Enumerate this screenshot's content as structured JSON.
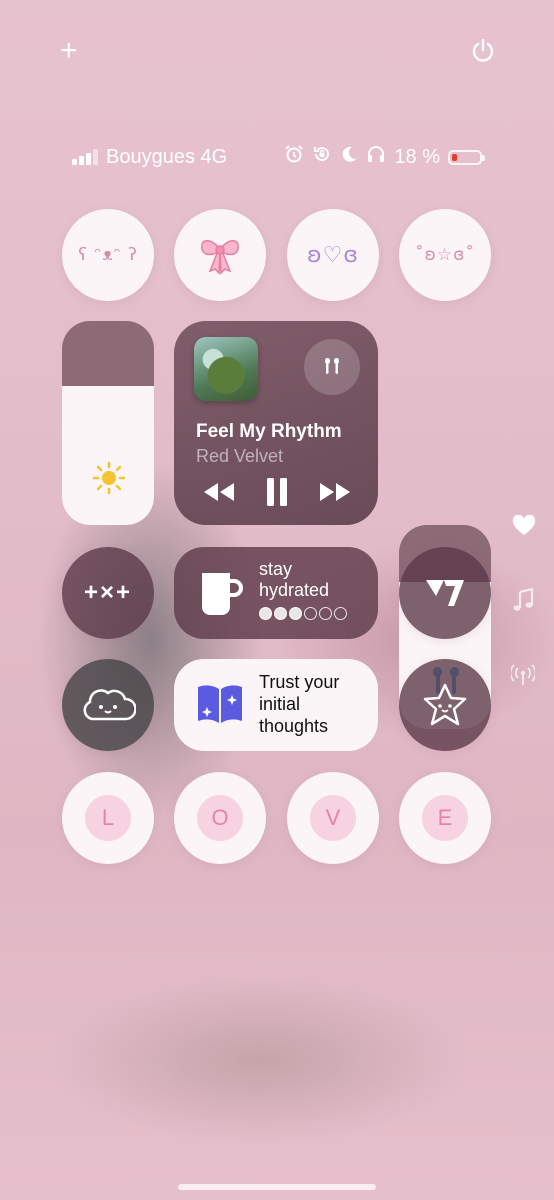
{
  "top": {
    "add_icon": "+",
    "power_icon": "power-icon"
  },
  "status": {
    "carrier": "Bouygues 4G",
    "battery_percent_label": "18 %",
    "battery_level": 0.18,
    "icons": [
      "alarm-icon",
      "rotation-lock-icon",
      "moon-icon",
      "headphones-icon"
    ]
  },
  "kaomoji_row": [
    {
      "text": "ʕ ᵔᴥᵔ ʔ",
      "name": "kaomoji-bear-button"
    },
    {
      "text": "🎀",
      "name": "bow-button"
    },
    {
      "text": "ʚ♡ɞ",
      "name": "kaomoji-heart-button"
    },
    {
      "text": "˚ʚ☆ɞ˚",
      "name": "kaomoji-star-button"
    }
  ],
  "brightness_level": 0.68,
  "volume_level": 0.72,
  "media": {
    "title": "Feel My Rhythm",
    "artist": "Red Velvet",
    "album_art": "Feel My Rhythm",
    "colors": {
      "accent_blue": "#3e9ee6"
    }
  },
  "hydration": {
    "label": "stay hydrated",
    "line1": "stay",
    "line2": "hydrated",
    "filled": 3,
    "total": 6
  },
  "affirmation": {
    "line1": "Trust your",
    "line2": "initial",
    "line3": "thoughts"
  },
  "tiles": {
    "plus_times_plus": "+×+",
    "logo_name": "seventeen-logo-icon"
  },
  "love_letters": [
    "L",
    "O",
    "V",
    "E"
  ],
  "side_icons": [
    "heart-icon",
    "music-note-icon",
    "broadcast-icon"
  ]
}
